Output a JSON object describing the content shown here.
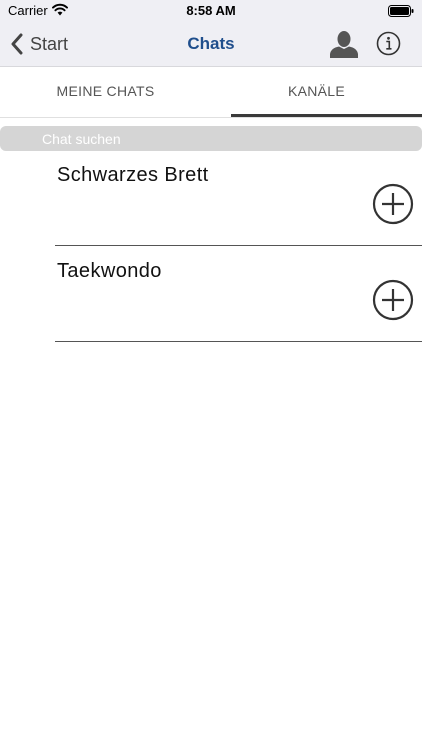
{
  "status_bar": {
    "carrier": "Carrier",
    "time": "8:58 AM"
  },
  "nav": {
    "back_label": "Start",
    "title": "Chats",
    "title_color": "#1f4e8c",
    "icons": [
      "chevron-left-icon",
      "person-icon",
      "info-icon"
    ]
  },
  "tabs": [
    {
      "label": "MEINE CHATS",
      "selected": false
    },
    {
      "label": "KANÄLE",
      "selected": true
    }
  ],
  "search": {
    "placeholder": "Chat suchen",
    "value": ""
  },
  "channels": [
    {
      "name": "Schwarzes Brett",
      "action_icon": "add-circle-icon"
    },
    {
      "name": "Taekwondo",
      "action_icon": "add-circle-icon"
    }
  ]
}
